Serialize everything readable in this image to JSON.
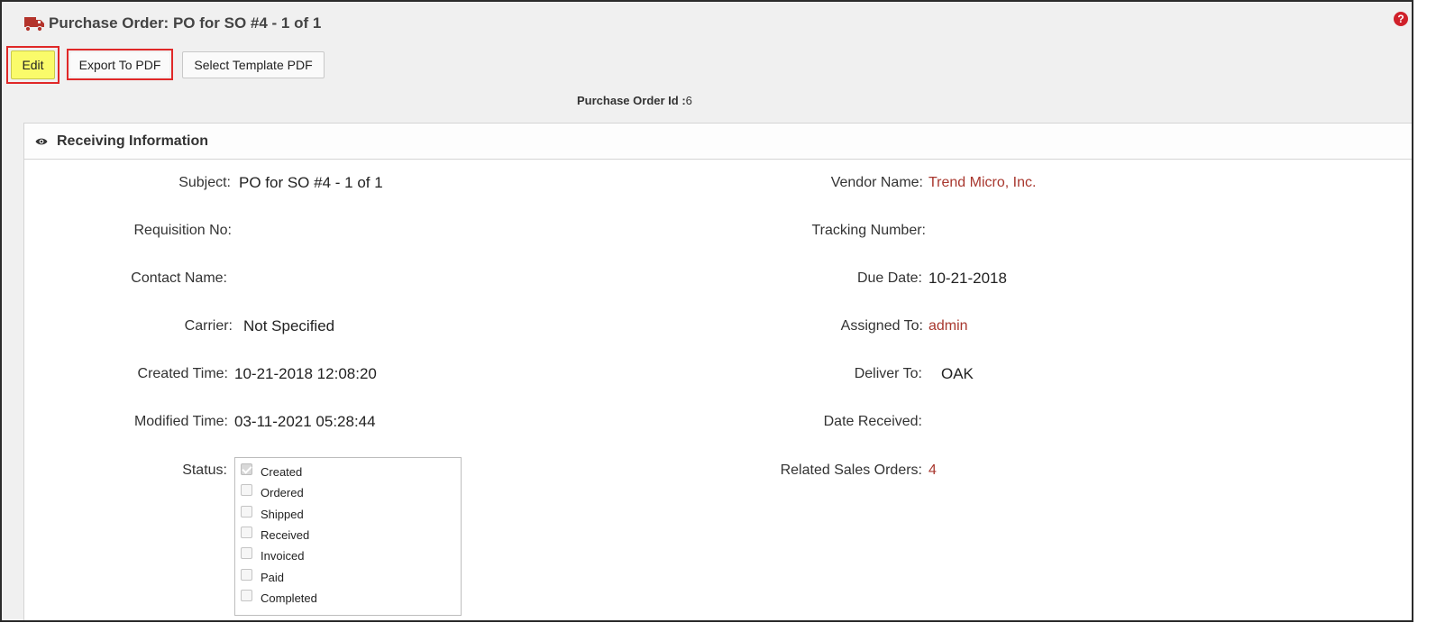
{
  "header": {
    "title": "Purchase Order: PO for SO #4 - 1 of 1",
    "help_icon": "?"
  },
  "toolbar": {
    "edit_label": "Edit",
    "export_label": "Export To PDF",
    "template_label": "Select Template PDF"
  },
  "po_id": {
    "label": "Purchase Order Id :",
    "value": "6"
  },
  "section": {
    "title": "Receiving Information"
  },
  "fields": {
    "subject": {
      "label": "Subject:",
      "value": "PO for SO #4 - 1 of 1"
    },
    "requisition_no": {
      "label": "Requisition No:",
      "value": ""
    },
    "contact_name": {
      "label": "Contact Name:",
      "value": ""
    },
    "carrier": {
      "label": "Carrier:",
      "value": "Not Specified"
    },
    "created_time": {
      "label": "Created Time:",
      "value": "10-21-2018 12:08:20"
    },
    "modified_time": {
      "label": "Modified Time:",
      "value": "03-11-2021 05:28:44"
    },
    "status": {
      "label": "Status:"
    },
    "vendor_name": {
      "label": "Vendor Name:",
      "value": "Trend Micro, Inc."
    },
    "tracking_number": {
      "label": "Tracking Number:",
      "value": ""
    },
    "due_date": {
      "label": "Due Date:",
      "value": "10-21-2018"
    },
    "assigned_to": {
      "label": "Assigned To:",
      "value": "admin"
    },
    "deliver_to": {
      "label": "Deliver To:",
      "value": "OAK"
    },
    "date_received": {
      "label": "Date Received:",
      "value": ""
    },
    "related_sales_orders": {
      "label": "Related Sales Orders:",
      "value": "4"
    }
  },
  "status_options": [
    {
      "label": "Created",
      "checked": true
    },
    {
      "label": "Ordered",
      "checked": false
    },
    {
      "label": "Shipped",
      "checked": false
    },
    {
      "label": "Received",
      "checked": false
    },
    {
      "label": "Invoiced",
      "checked": false
    },
    {
      "label": "Paid",
      "checked": false
    },
    {
      "label": "Completed",
      "checked": false
    }
  ],
  "colors": {
    "link": "#a8372e",
    "edit_button": "#fafb6a",
    "highlight_border": "#e02828",
    "truck_icon": "#b3332b",
    "help_icon": "#d0202a"
  }
}
